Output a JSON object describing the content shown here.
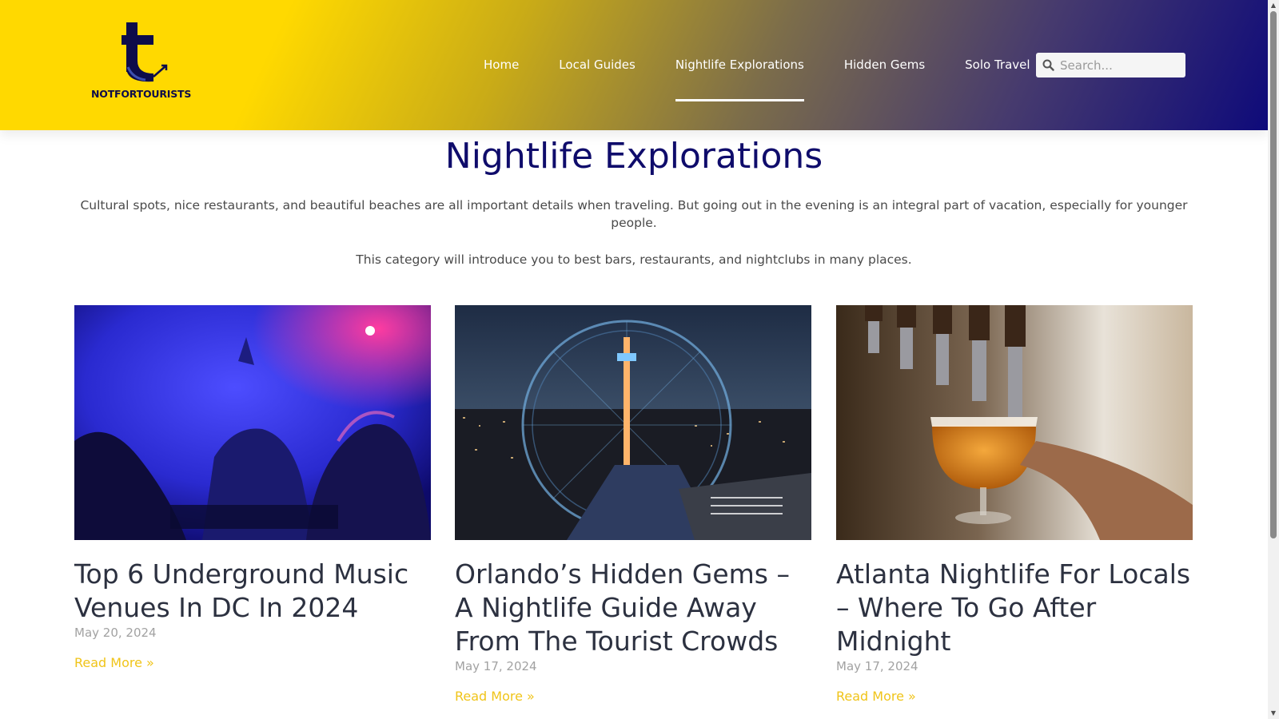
{
  "brand": {
    "name": "NOTFORTOURISTS",
    "colors": {
      "yellow": "#ffd900",
      "navy": "#0f0c6b",
      "link": "#f0c419"
    }
  },
  "nav": {
    "items": [
      {
        "label": "Home"
      },
      {
        "label": "Local Guides"
      },
      {
        "label": "Nightlife Explorations",
        "active": true
      },
      {
        "label": "Hidden Gems"
      },
      {
        "label": "Solo Travel"
      }
    ]
  },
  "search": {
    "placeholder": "Search...",
    "value": ""
  },
  "page": {
    "title": "Nightlife Explorations",
    "intro": "Cultural spots, nice restaurants, and beautiful beaches are all important details when traveling. But going out in the evening is an integral part of vacation, especially for younger people.",
    "intro2": "This category will introduce you to best bars, restaurants, and nightclubs in many places."
  },
  "posts": [
    {
      "title": "Top 6 Underground Music Venues In DC In 2024",
      "date": "May 20, 2024",
      "read_more": "Read More »",
      "image": "dj-club-photo"
    },
    {
      "title": "Orlando’s Hidden Gems – A Nightlife Guide Away From The Tourist Crowds",
      "date": "May 17, 2024",
      "read_more": "Read More »",
      "image": "ferris-wheel-night-photo"
    },
    {
      "title": "Atlanta Nightlife For Locals – Where To Go After Midnight",
      "date": "May 17, 2024",
      "read_more": "Read More »",
      "image": "beer-tap-photo"
    }
  ]
}
